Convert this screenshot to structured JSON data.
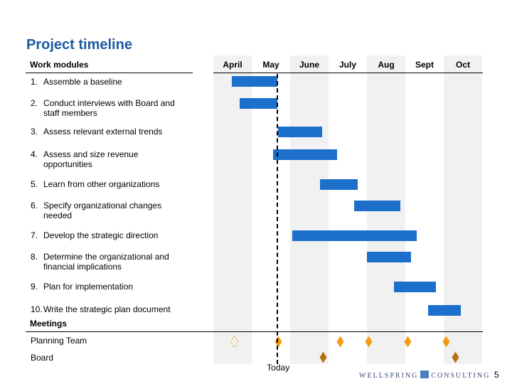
{
  "title": "Project timeline",
  "left_header": "Work modules",
  "months": [
    "April",
    "May",
    "June",
    "July",
    "Aug",
    "Sept",
    "Oct"
  ],
  "chart_data": {
    "type": "gantt",
    "title": "Project timeline",
    "x_axis": {
      "unit": "months from start of April",
      "range": [
        0,
        7
      ],
      "tick_labels": [
        "April",
        "May",
        "June",
        "July",
        "Aug",
        "Sept",
        "Oct"
      ]
    },
    "shaded_months": [
      "April",
      "June",
      "Aug",
      "Oct"
    ],
    "tasks": [
      {
        "num": "1.",
        "label": "Assemble a baseline",
        "start": 0.48,
        "end": 1.67
      },
      {
        "num": "2.",
        "label": "Conduct interviews with Board and staff members",
        "start": 0.69,
        "end": 1.67
      },
      {
        "num": "3.",
        "label": "Assess relevant external trends",
        "start": 1.69,
        "end": 2.83
      },
      {
        "num": "4.",
        "label": "Assess and size revenue opportunities",
        "start": 1.56,
        "end": 3.22
      },
      {
        "num": "5.",
        "label": "Learn from other organizations",
        "start": 2.78,
        "end": 3.76
      },
      {
        "num": "6.",
        "label": "Specify organizational changes needed",
        "start": 3.67,
        "end": 4.87
      },
      {
        "num": "7.",
        "label": "Develop the strategic direction",
        "start": 2.06,
        "end": 5.3
      },
      {
        "num": "8.",
        "label": "Determine the organizational and financial implications",
        "start": 4.0,
        "end": 5.15
      },
      {
        "num": "9.",
        "label": "Plan for implementation",
        "start": 4.7,
        "end": 5.8
      },
      {
        "num": "10.",
        "label": "Write the strategic plan document",
        "start": 5.59,
        "end": 6.44
      }
    ],
    "meetings_header": "Meetings",
    "meetings": [
      {
        "label": "Planning Team",
        "color": "#f59b12",
        "events": [
          {
            "t": 0.54,
            "status": "tentative"
          },
          {
            "t": 1.69,
            "status": "scheduled"
          },
          {
            "t": 3.3,
            "status": "scheduled"
          },
          {
            "t": 4.04,
            "status": "scheduled"
          },
          {
            "t": 5.07,
            "status": "scheduled"
          },
          {
            "t": 6.07,
            "status": "scheduled"
          }
        ]
      },
      {
        "label": "Board",
        "color": "#b8720f",
        "events": [
          {
            "t": 2.87,
            "status": "scheduled"
          },
          {
            "t": 6.31,
            "status": "scheduled"
          }
        ]
      }
    ],
    "today": {
      "label": "Today",
      "t": 1.67
    }
  },
  "footer": {
    "logo_left": "WELLSPRING",
    "logo_right": "CONSULTING",
    "page": "5"
  }
}
